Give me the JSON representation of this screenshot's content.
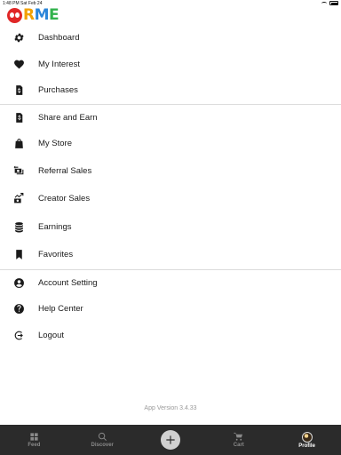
{
  "status_bar": {
    "time": "1:48 PM",
    "date": "Sat Feb 24"
  },
  "logo": {
    "o": "O",
    "r": "R",
    "m": "M",
    "e": "E"
  },
  "menu": {
    "sections": [
      {
        "items": [
          {
            "label": "Dashboard",
            "icon": "gear-icon"
          },
          {
            "label": "My Interest",
            "icon": "heart-icon"
          },
          {
            "label": "Purchases",
            "icon": "receipt-dollar-icon"
          }
        ]
      },
      {
        "items": [
          {
            "label": "Share and Earn",
            "icon": "share-dollar-icon"
          },
          {
            "label": "My Store",
            "icon": "shopping-bag-icon"
          },
          {
            "label": "Referral Sales",
            "icon": "cash-exchange-icon"
          },
          {
            "label": "Creator Sales",
            "icon": "cash-trend-icon"
          },
          {
            "label": "Earnings",
            "icon": "coins-icon"
          },
          {
            "label": "Favorites",
            "icon": "bookmark-icon"
          }
        ]
      },
      {
        "items": [
          {
            "label": "Account Setting",
            "icon": "user-circle-icon"
          },
          {
            "label": "Help Center",
            "icon": "question-circle-icon"
          },
          {
            "label": "Logout",
            "icon": "logout-icon"
          }
        ]
      }
    ]
  },
  "app_version": "App Version 3.4.33",
  "tabs": [
    {
      "label": "Feed",
      "icon": "grid-icon"
    },
    {
      "label": "Discover",
      "icon": "search-icon"
    },
    {
      "label": "",
      "icon": "plus-icon"
    },
    {
      "label": "Cart",
      "icon": "cart-icon"
    },
    {
      "label": "Profile",
      "icon": "avatar",
      "active": true
    }
  ]
}
